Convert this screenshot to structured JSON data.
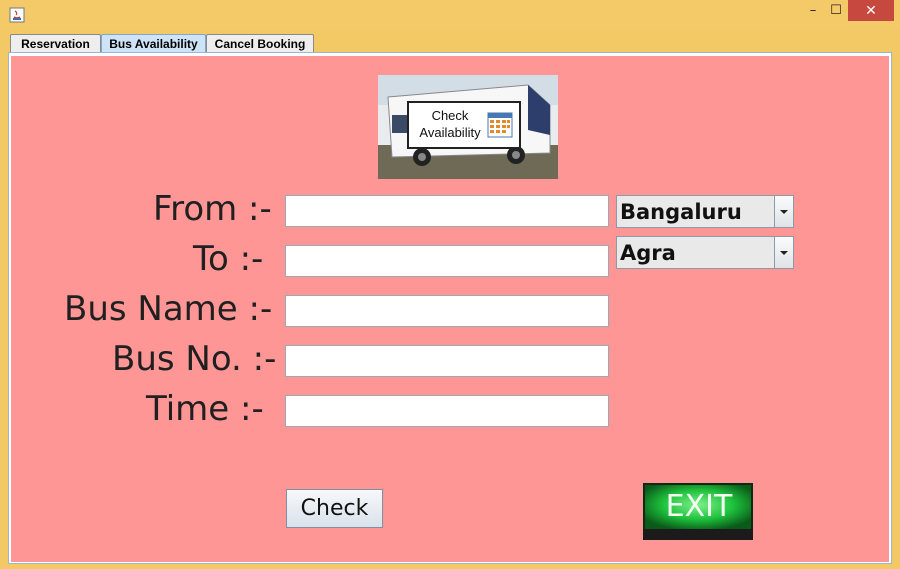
{
  "window": {
    "title": "",
    "controls": {
      "minimize": "–",
      "maximize": "☐",
      "close": "✕"
    }
  },
  "tabs": [
    {
      "label": "Reservation",
      "active": false
    },
    {
      "label": "Bus Availability",
      "active": true
    },
    {
      "label": "Cancel Booking",
      "active": false
    }
  ],
  "banner": {
    "line1": "Check",
    "line2": "Availability"
  },
  "form": {
    "from_label": "From :-",
    "to_label": "To :-",
    "bus_name_label": "Bus Name :-",
    "bus_no_label": "Bus No. :-",
    "time_label": "Time :-",
    "from_value": "",
    "to_value": "",
    "bus_name_value": "",
    "bus_no_value": "",
    "time_value": ""
  },
  "combos": {
    "from_selected": "Bangaluru",
    "to_selected": "Agra"
  },
  "buttons": {
    "check_label": "Check",
    "exit_label": "EXIT"
  },
  "colors": {
    "panel_bg": "#ff9696",
    "title_bar": "#f4ca68",
    "close_button": "#c6483f",
    "exit_sign": "#2fd84a"
  }
}
